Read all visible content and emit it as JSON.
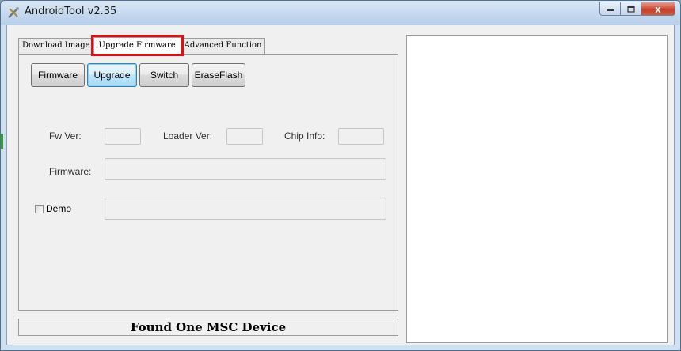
{
  "window": {
    "title": "AndroidTool v2.35",
    "controls": {
      "minimize": "─",
      "maximize": "□",
      "close": "x"
    }
  },
  "tabs": [
    {
      "label": "Download Image",
      "active": false
    },
    {
      "label": "Upgrade Firmware",
      "active": true
    },
    {
      "label": "Advanced Function",
      "active": false
    }
  ],
  "toolbar": {
    "firmware_label": "Firmware",
    "upgrade_label": "Upgrade",
    "switch_label": "Switch",
    "erase_flash_label": "EraseFlash"
  },
  "info": {
    "fw_ver_label": "Fw Ver:",
    "fw_ver_value": "",
    "loader_ver_label": "Loader Ver:",
    "loader_ver_value": "",
    "chip_info_label": "Chip Info:",
    "chip_info_value": ""
  },
  "firmware_path": {
    "label": "Firmware:",
    "value": ""
  },
  "demo": {
    "label": "Demo",
    "checked": false,
    "value": ""
  },
  "status": {
    "text": "Found One MSC Device"
  },
  "colors": {
    "highlight_box": "#e01010",
    "focused_button": "#3c7fb1",
    "title_bar": "#c4d8ee",
    "close_button": "#c6412b"
  }
}
